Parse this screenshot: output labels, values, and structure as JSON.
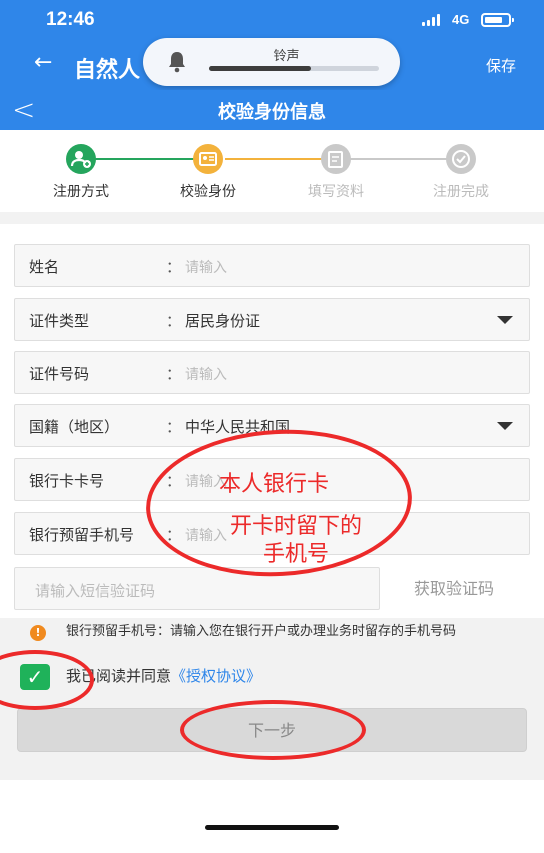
{
  "status_bar": {
    "time": "12:46",
    "network": "4G"
  },
  "outer_header": {
    "back_glyph": "←",
    "title": "自然人",
    "save_label": "保存"
  },
  "ringer_popup": {
    "label": "铃声",
    "volume_level": 0.6
  },
  "inner_header": {
    "back_glyph": "<",
    "title": "校验身份信息"
  },
  "steps": [
    {
      "label": "注册方式",
      "state": "done",
      "color": "#25a55d",
      "icon": "user-add-icon"
    },
    {
      "label": "校验身份",
      "state": "current",
      "color": "#f3b23c",
      "icon": "id-card-icon"
    },
    {
      "label": "填写资料",
      "state": "pending",
      "color": "#c9c9c9",
      "icon": "edit-icon"
    },
    {
      "label": "注册完成",
      "state": "pending",
      "color": "#c9c9c9",
      "icon": "check-icon"
    }
  ],
  "form": {
    "name": {
      "label": "姓名",
      "placeholder": "请输入"
    },
    "id_type": {
      "label": "证件类型",
      "value": "居民身份证"
    },
    "id_number": {
      "label": "证件号码",
      "placeholder": "请输入"
    },
    "nationality": {
      "label": "国籍（地区）",
      "value": "中华人民共和国"
    },
    "bank_card": {
      "label": "银行卡卡号",
      "placeholder": "请输入"
    },
    "bank_phone": {
      "label": "银行预留手机号",
      "placeholder": "请输入"
    },
    "colon": "："
  },
  "sms": {
    "placeholder": "请输入短信验证码",
    "button": "获取验证码"
  },
  "notice": {
    "label": "银行预留手机号：",
    "text": "请输入您在银行开户或办理业务时留存的手机号码"
  },
  "agreement": {
    "text": "我已阅读并同意",
    "link": "《授权协议》",
    "checked": true
  },
  "next_button": "下一步",
  "annotations": {
    "line1": "本人银行卡",
    "line2": "开卡时留下的",
    "line3": "手机号",
    "color": "#ec2a2a"
  },
  "colors": {
    "primary": "#2f86e9",
    "success": "#1fb25a",
    "warning": "#f08a1f"
  }
}
